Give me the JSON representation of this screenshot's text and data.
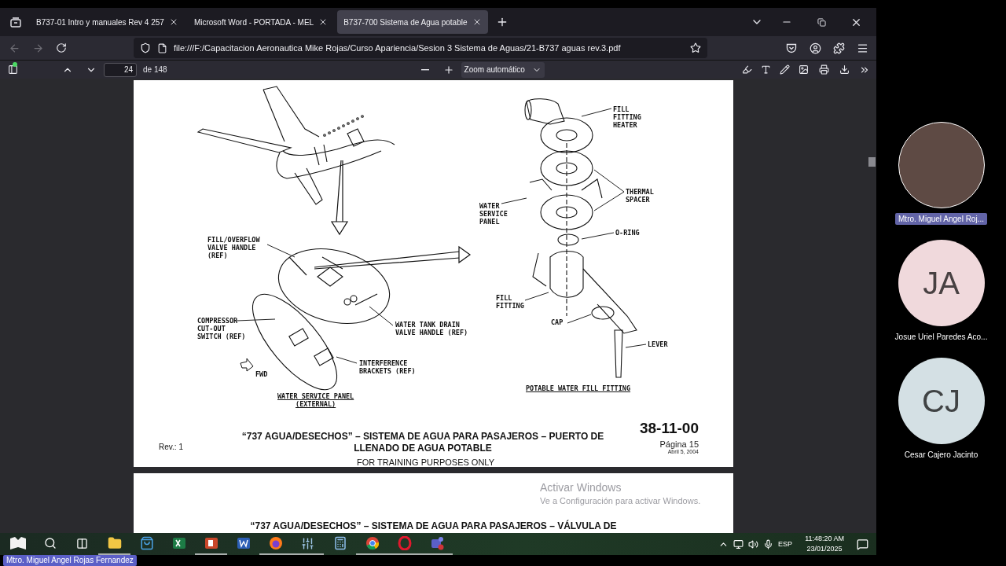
{
  "browser": {
    "tabs": [
      {
        "label": "B737-01 Intro y manuales Rev 4 257",
        "selected": false
      },
      {
        "label": "Microsoft Word - PORTADA - MEL",
        "selected": false
      },
      {
        "label": "B737-700 Sistema de Agua potable",
        "selected": true
      }
    ],
    "address": "file:///F:/Capacitacion Aeronautica Mike Rojas/Curso Apariencia/Sesion 3 Sistema de Aguas/21-B737 aguas rev.3.pdf"
  },
  "pdf_toolbar": {
    "page": "24",
    "page_count": "de 148",
    "zoom": "Zoom automático"
  },
  "document": {
    "callouts": [
      {
        "kind": "callout",
        "lines": [
          "FILL/OVERFLOW",
          "VALVE HANDLE",
          "(REF)"
        ]
      },
      {
        "kind": "callout",
        "lines": [
          "COMPRESSOR",
          "CUT-OUT",
          "SWITCH (REF)"
        ]
      },
      {
        "kind": "callout",
        "lines": [
          "WATER TANK DRAIN",
          "VALVE HANDLE (REF)"
        ]
      },
      {
        "kind": "callout",
        "lines": [
          "INTERFERENCE",
          "BRACKETS (REF)"
        ]
      },
      {
        "kind": "callout",
        "lines": [
          "FWD"
        ]
      },
      {
        "kind": "caption",
        "lines": [
          "WATER SERVICE PANEL",
          "(EXTERNAL)"
        ]
      },
      {
        "kind": "callout",
        "lines": [
          "FILL",
          "FITTING",
          "HEATER"
        ]
      },
      {
        "kind": "callout",
        "lines": [
          "THERMAL",
          "SPACER"
        ]
      },
      {
        "kind": "callout",
        "lines": [
          "WATER",
          "SERVICE",
          "PANEL"
        ]
      },
      {
        "kind": "callout",
        "lines": [
          "O-RING"
        ]
      },
      {
        "kind": "callout",
        "lines": [
          "FILL",
          "FITTING"
        ]
      },
      {
        "kind": "callout",
        "lines": [
          "CAP"
        ]
      },
      {
        "kind": "callout",
        "lines": [
          "LEVER"
        ]
      },
      {
        "kind": "caption",
        "lines": [
          "POTABLE WATER FILL FITTING"
        ]
      }
    ],
    "revision": "Rev.: 1",
    "title_lines": [
      "“737 AGUA/DESECHOS” – SISTEMA DE AGUA PARA PASAJEROS – PUERTO DE",
      "LLENADO DE AGUA POTABLE"
    ],
    "section_code": "38-11-00",
    "page_label": "Página 15",
    "date": "Abril 5, 2004",
    "notice": "FOR TRAINING PURPOSES ONLY",
    "next_page_title": "“737 AGUA/DESECHOS” – SISTEMA DE AGUA PARA PASAJEROS – VÁLVULA DE"
  },
  "activation": {
    "title": "Activar Windows",
    "text": "Ve a Configuración para activar Windows."
  },
  "taskbar": {
    "apps": [
      {
        "kind": "start",
        "running": false
      },
      {
        "kind": "search",
        "running": false
      },
      {
        "kind": "taskview",
        "running": false
      },
      {
        "kind": "folder",
        "running": true
      },
      {
        "kind": "store",
        "running": false
      },
      {
        "kind": "sheet",
        "running": false
      },
      {
        "kind": "slides",
        "running": true
      },
      {
        "kind": "doc",
        "running": false
      },
      {
        "kind": "fox",
        "running": true
      },
      {
        "kind": "mixer",
        "running": true
      },
      {
        "kind": "calc",
        "running": false
      },
      {
        "kind": "chromium",
        "running": true
      },
      {
        "kind": "ring",
        "running": true
      },
      {
        "kind": "chat",
        "running": true
      }
    ],
    "language": "ESP",
    "time": "11:48:20 AM",
    "date": "23/01/2025"
  },
  "participants": [
    {
      "kind": "video",
      "name": "Mtro. Miguel Angel Roj...",
      "speaking": true
    },
    {
      "kind": "avatar",
      "initials": "JA",
      "color": "#f0d9dc",
      "name": "Josue Uriel Paredes Aco...",
      "speaking": false
    },
    {
      "kind": "avatar",
      "initials": "CJ",
      "color": "#d4e0e4",
      "name": "Cesar Cajero Jacinto",
      "speaking": false
    }
  ],
  "presenter": "Mtro. Miguel Angel Rojas Fernandez"
}
